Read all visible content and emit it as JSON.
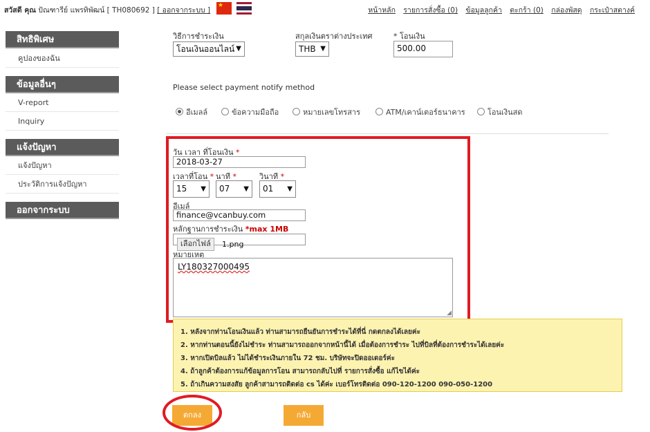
{
  "topbar": {
    "greeting_prefix": "สวัสดี คุณ",
    "user_name": "ปัณฑารีย์ แพรทิพัฒน์",
    "user_code": "[ TH080692 ]",
    "logout_link": "[ ออกจากระบบ ]",
    "nav": [
      "หน้าหลัก",
      "รายการสั่งซื้อ (0)",
      "ข้อมูลลูกค้า",
      "ตะกร้า (0)",
      "กล่องพัสดุ",
      "กระเป๋าสตางค์"
    ],
    "flags": [
      "china-flag-icon",
      "thailand-flag-icon"
    ]
  },
  "sidebar": {
    "sections": [
      {
        "header": "สิทธิพิเศษ",
        "items": [
          "คูปองของฉัน"
        ]
      },
      {
        "header": "ข้อมูลอื่นๆ",
        "items": [
          "V-report",
          "Inquiry"
        ]
      },
      {
        "header": "แจ้งปัญหา",
        "items": [
          "แจ้งปัญหา",
          "ประวัติการแจ้งปัญหา"
        ]
      },
      {
        "header": "ออกจากระบบ",
        "items": []
      }
    ]
  },
  "payment": {
    "method_label": "วิธีการชำระเงิน",
    "method_value": "โอนเงินออนไลน์",
    "currency_label": "สกุลเงินตราต่างประเทศ",
    "currency_value": "THB",
    "amount_label": "* โอนเงิน",
    "amount_value": "500.00"
  },
  "notify": {
    "title": "Please select payment notify method",
    "options": [
      "อีเมลล์",
      "ข้อความมือถือ",
      "หมายเลขโทรสาร",
      "ATM/เคาน์เตอร์ธนาคาร",
      "โอนเงินสด"
    ],
    "selected_index": 0
  },
  "form": {
    "date_label": "วัน เวลา ที่โอนเงิน",
    "date_value": "2018-03-27",
    "hour_label": "เวลาที่โอน",
    "minute_label": "นาที",
    "second_label": "วินาที",
    "hour_value": "15",
    "minute_value": "07",
    "second_value": "01",
    "email_label": "อีเมล์",
    "email_value": "finance@vcanbuy.com",
    "proof_label": "หลักฐานการชำระเงิน",
    "proof_note": "*max 1MB",
    "file_button": "เลือกไฟล์",
    "file_name": "1.png",
    "remark_label": "หมายเหตุ",
    "remark_value": "LY180327000495",
    "required_mark": "*"
  },
  "notes": [
    "1. หลังจากท่านโอนเงินแล้ว ท่านสามารถยืนยันการชำระได้ที่นี่ กดตกลงได้เลยค่ะ",
    "2. หากท่านตอนนี้ยังไม่ชำระ ท่านสามารถออกจากหน้านี้ได้ เมื่อต้องการชำระ ไปที่บิลที่ต้องการชำระได้เลยค่ะ",
    "3. หากเปิดบิลแล้ว ไม่ได้ชำระเงินภายใน 72 ชม. บริษัทจะปิดออเดอร์ค่ะ",
    "4. ถ้าลูกค้าต้องการแก้ข้อมูลการโอน สามารถกลับไปที่ รายการสั่งซื้อ แก้ไขได้ค่ะ",
    "5. ถ้าเกินความสงสัย ลูกค้าสามารถติดต่อ cs ได้ค่ะ เบอร์โทรติดต่อ 090-120-1200 090-050-1200"
  ],
  "buttons": {
    "confirm": "ตกลง",
    "back": "กลับ"
  },
  "colors": {
    "accent_orange": "#f5a935",
    "highlight_red": "#e01b22",
    "sidebar_header": "#5b5b5b",
    "notes_bg": "#fdf3b1"
  }
}
